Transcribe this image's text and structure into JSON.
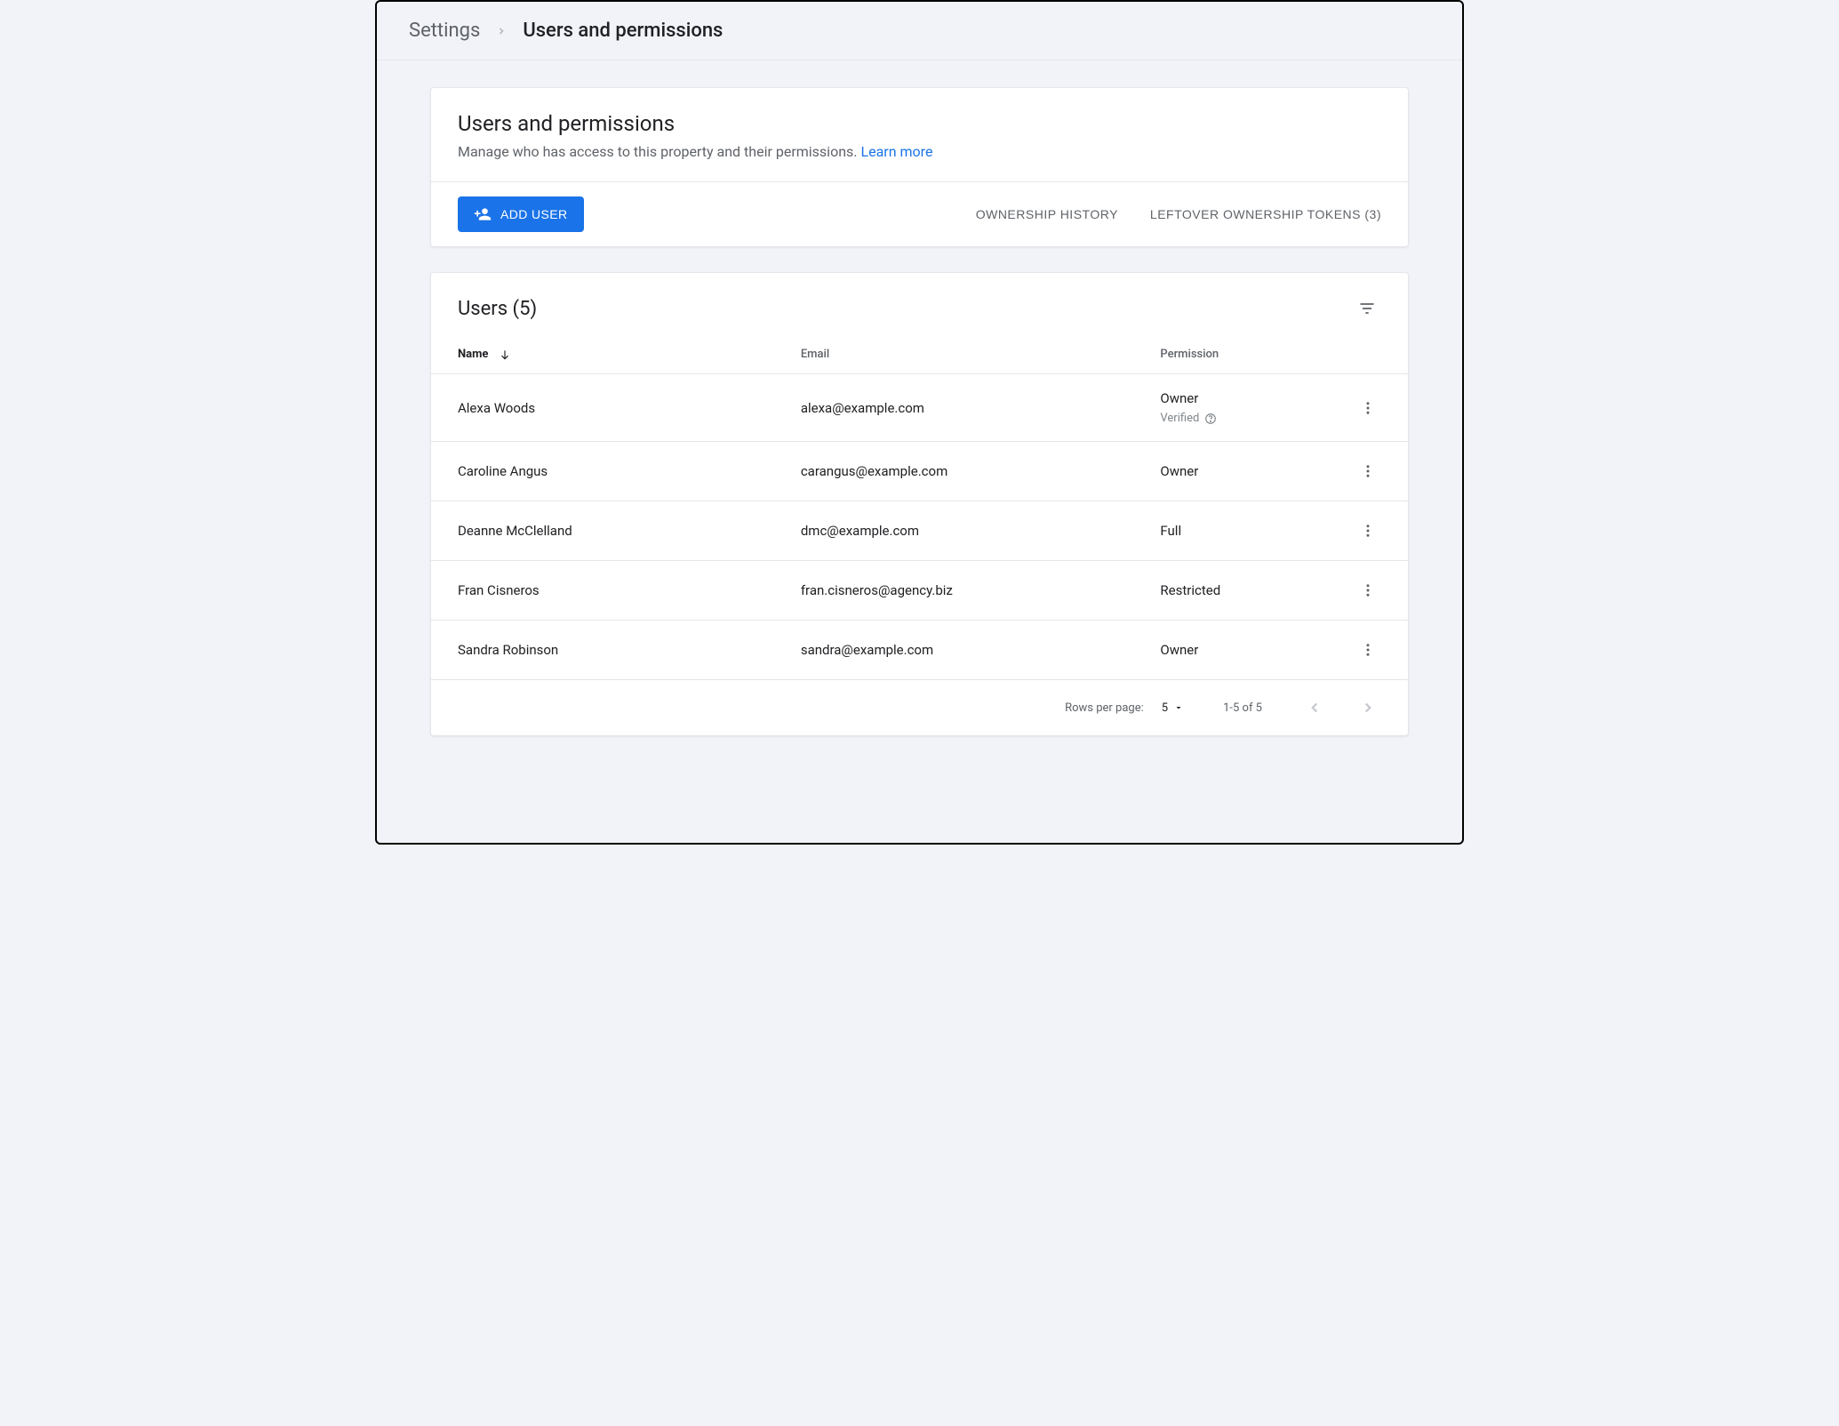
{
  "breadcrumb": {
    "root": "Settings",
    "current": "Users and permissions"
  },
  "header": {
    "title": "Users and permissions",
    "description": "Manage who has access to this property and their permissions.",
    "learn_more": "Learn more",
    "add_user_label": "ADD USER",
    "ownership_history_label": "OWNERSHIP HISTORY",
    "leftover_tokens_label": "LEFTOVER OWNERSHIP TOKENS (3)"
  },
  "users_section": {
    "title": "Users (5)",
    "columns": {
      "name": "Name",
      "email": "Email",
      "permission": "Permission"
    },
    "verified_label": "Verified",
    "rows": [
      {
        "name": "Alexa Woods",
        "email": "alexa@example.com",
        "permission": "Owner",
        "verified": true
      },
      {
        "name": "Caroline Angus",
        "email": "carangus@example.com",
        "permission": "Owner",
        "verified": false
      },
      {
        "name": "Deanne McClelland",
        "email": "dmc@example.com",
        "permission": "Full",
        "verified": false
      },
      {
        "name": "Fran Cisneros",
        "email": "fran.cisneros@agency.biz",
        "permission": "Restricted",
        "verified": false
      },
      {
        "name": "Sandra Robinson",
        "email": "sandra@example.com",
        "permission": "Owner",
        "verified": false
      }
    ]
  },
  "pagination": {
    "rows_per_page_label": "Rows per page:",
    "rows_per_page_value": "5",
    "range_label": "1-5 of 5"
  }
}
